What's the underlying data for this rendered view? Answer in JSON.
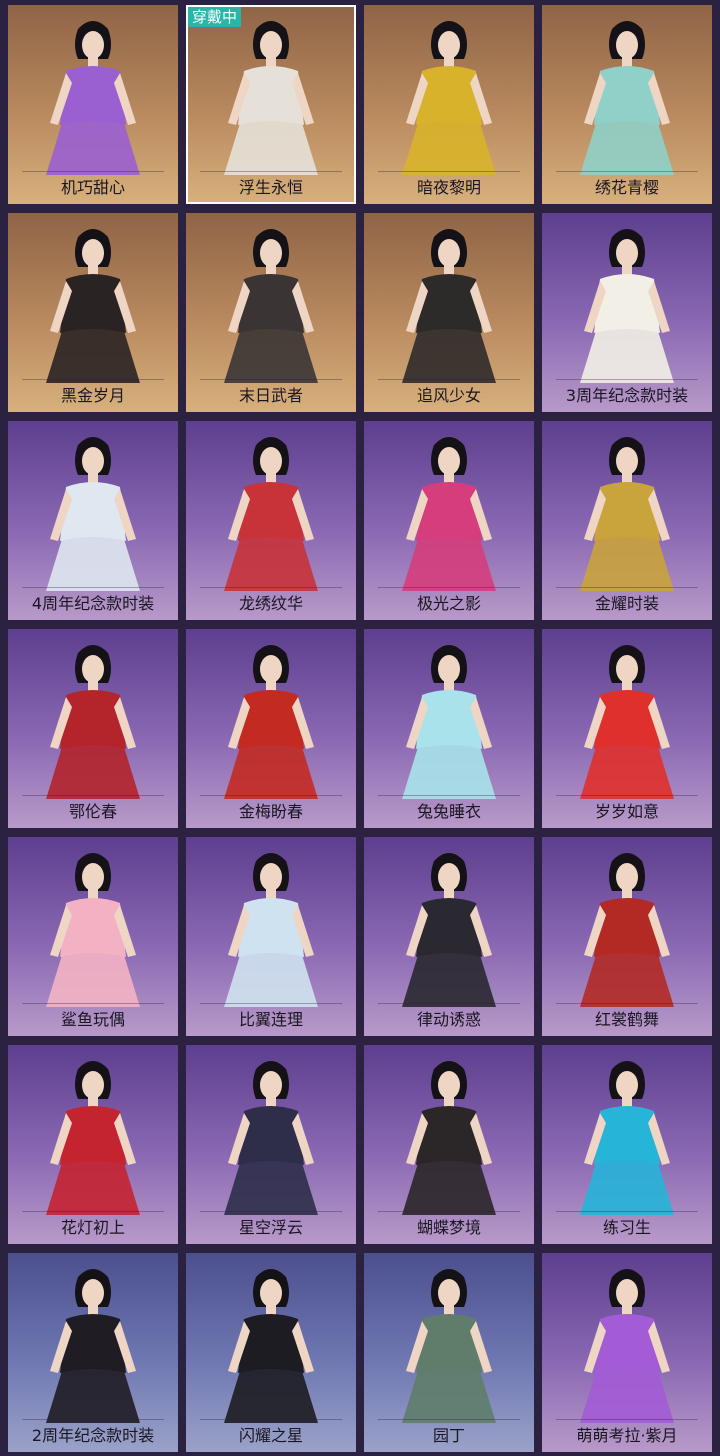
{
  "wearing_badge": "穿戴中",
  "outfits": [
    {
      "name": "机巧甜心",
      "bg": "warm",
      "color": "#9a5fd1",
      "selected": false
    },
    {
      "name": "浮生永恒",
      "bg": "warm",
      "color": "#e6e1d8",
      "selected": true
    },
    {
      "name": "暗夜黎明",
      "bg": "warm",
      "color": "#d8b22a",
      "selected": false
    },
    {
      "name": "绣花青樱",
      "bg": "warm",
      "color": "#8fd0c8",
      "selected": false
    },
    {
      "name": "黑金岁月",
      "bg": "warm",
      "color": "#2a2323",
      "selected": false
    },
    {
      "name": "末日武者",
      "bg": "warm",
      "color": "#3a3534",
      "selected": false
    },
    {
      "name": "追风少女",
      "bg": "warm",
      "color": "#2d2a2a",
      "selected": false
    },
    {
      "name": "3周年纪念款时装",
      "bg": "purple",
      "color": "#f2efe6",
      "selected": false
    },
    {
      "name": "4周年纪念款时装",
      "bg": "purple",
      "color": "#dfe7f0",
      "selected": false
    },
    {
      "name": "龙绣纹华",
      "bg": "purple",
      "color": "#c8333a",
      "selected": false
    },
    {
      "name": "极光之影",
      "bg": "purple",
      "color": "#d63d7c",
      "selected": false
    },
    {
      "name": "金耀时装",
      "bg": "purple",
      "color": "#c9a33b",
      "selected": false
    },
    {
      "name": "鄂伦春",
      "bg": "purple",
      "color": "#b4242b",
      "selected": false
    },
    {
      "name": "金梅盼春",
      "bg": "purple",
      "color": "#c32a22",
      "selected": false
    },
    {
      "name": "兔兔睡衣",
      "bg": "purple",
      "color": "#a9e2ea",
      "selected": false
    },
    {
      "name": "岁岁如意",
      "bg": "purple",
      "color": "#e0302c",
      "selected": false
    },
    {
      "name": "鲨鱼玩偶",
      "bg": "purple",
      "color": "#f3b2c3",
      "selected": false
    },
    {
      "name": "比翼连理",
      "bg": "purple",
      "color": "#cfe2f0",
      "selected": false
    },
    {
      "name": "律动诱惑",
      "bg": "purple",
      "color": "#2a2830",
      "selected": false
    },
    {
      "name": "红裳鹤舞",
      "bg": "purple",
      "color": "#b32a25",
      "selected": false
    },
    {
      "name": "花灯初上",
      "bg": "purple",
      "color": "#c42430",
      "selected": false
    },
    {
      "name": "星空浮云",
      "bg": "purple",
      "color": "#2e2d4a",
      "selected": false
    },
    {
      "name": "蝴蝶梦境",
      "bg": "purple",
      "color": "#2b2628",
      "selected": false
    },
    {
      "name": "练习生",
      "bg": "purple",
      "color": "#26b4d8",
      "selected": false
    },
    {
      "name": "2周年纪念款时装",
      "bg": "blue",
      "color": "#1f1c24",
      "selected": false
    },
    {
      "name": "闪耀之星",
      "bg": "blue",
      "color": "#1d1c22",
      "selected": false
    },
    {
      "name": "园丁",
      "bg": "blue",
      "color": "#5f7d6a",
      "selected": false
    },
    {
      "name": "萌萌考拉·紫月",
      "bg": "purple",
      "color": "#a35bd6",
      "selected": false
    }
  ]
}
